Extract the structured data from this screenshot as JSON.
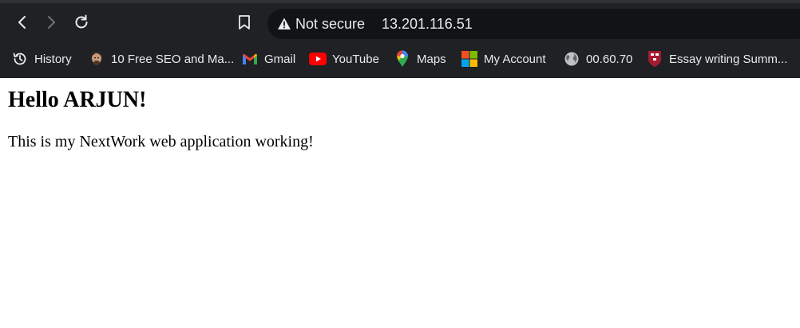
{
  "browser": {
    "security_label": "Not secure",
    "url": "13.201.116.51",
    "bookmarks": [
      {
        "label": "History",
        "icon": "history-icon"
      },
      {
        "label": "10 Free SEO and Ma...",
        "icon": "person-avatar-icon"
      },
      {
        "label": "Gmail",
        "icon": "gmail-icon"
      },
      {
        "label": "YouTube",
        "icon": "youtube-icon"
      },
      {
        "label": "Maps",
        "icon": "maps-pin-icon"
      },
      {
        "label": "My Account",
        "icon": "microsoft-icon"
      },
      {
        "label": "00.60.70",
        "icon": "globe-icon"
      },
      {
        "label": "Essay writing Summ...",
        "icon": "harvard-shield-icon"
      }
    ]
  },
  "page": {
    "heading": "Hello ARJUN!",
    "body": "This is my NextWork web application working!"
  },
  "colors": {
    "chrome_bg": "#202124",
    "omnibox_bg": "#121316",
    "youtube_red": "#ff0000",
    "gmail_red": "#ea4335"
  }
}
